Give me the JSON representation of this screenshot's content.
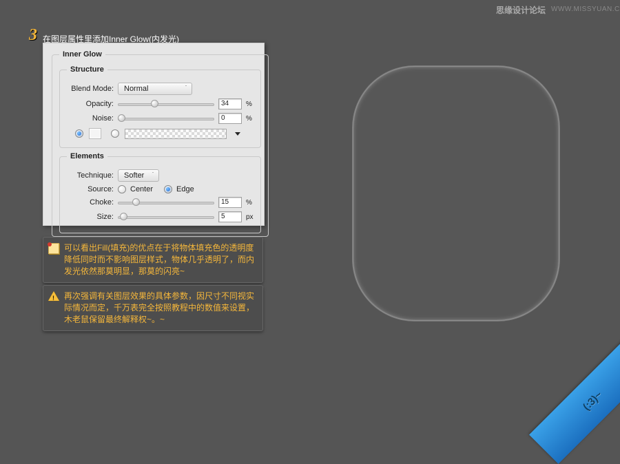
{
  "watermark": {
    "logo": "思缘设计论坛",
    "url": "WWW.MISSYUAN.COM"
  },
  "step": {
    "number": "3",
    "label": "在图层属性里添加Inner Glow(内发光)"
  },
  "panel": {
    "legend_main": "Inner Glow",
    "structure": {
      "legend": "Structure",
      "blend_mode_label": "Blend Mode:",
      "blend_mode_value": "Normal",
      "opacity_label": "Opacity:",
      "opacity_value": "34",
      "opacity_unit": "%",
      "noise_label": "Noise:",
      "noise_value": "0",
      "noise_unit": "%"
    },
    "elements": {
      "legend": "Elements",
      "technique_label": "Technique:",
      "technique_value": "Softer",
      "source_label": "Source:",
      "source_center": "Center",
      "source_edge": "Edge",
      "choke_label": "Choke:",
      "choke_value": "15",
      "choke_unit": "%",
      "size_label": "Size:",
      "size_value": "5",
      "size_unit": "px"
    }
  },
  "notes": {
    "n1": "可以看出Fill(填充)的优点在于将物体填充色的透明度降低同时而不影响图层样式，物体几乎透明了，而内发光依然那莫明显，那莫的闪亮~",
    "n2": "再次强调有关图层效果的具体参数，因尺寸不同视实际情况而定，千万表完全按照教程中的数值来设置，木老鼠保留最终解释权~。~"
  },
  "ribbon": "(:3)~",
  "slider_positions": {
    "opacity_pct": 34,
    "noise_pct": 0,
    "choke_pct": 15,
    "size_pct": 2
  }
}
